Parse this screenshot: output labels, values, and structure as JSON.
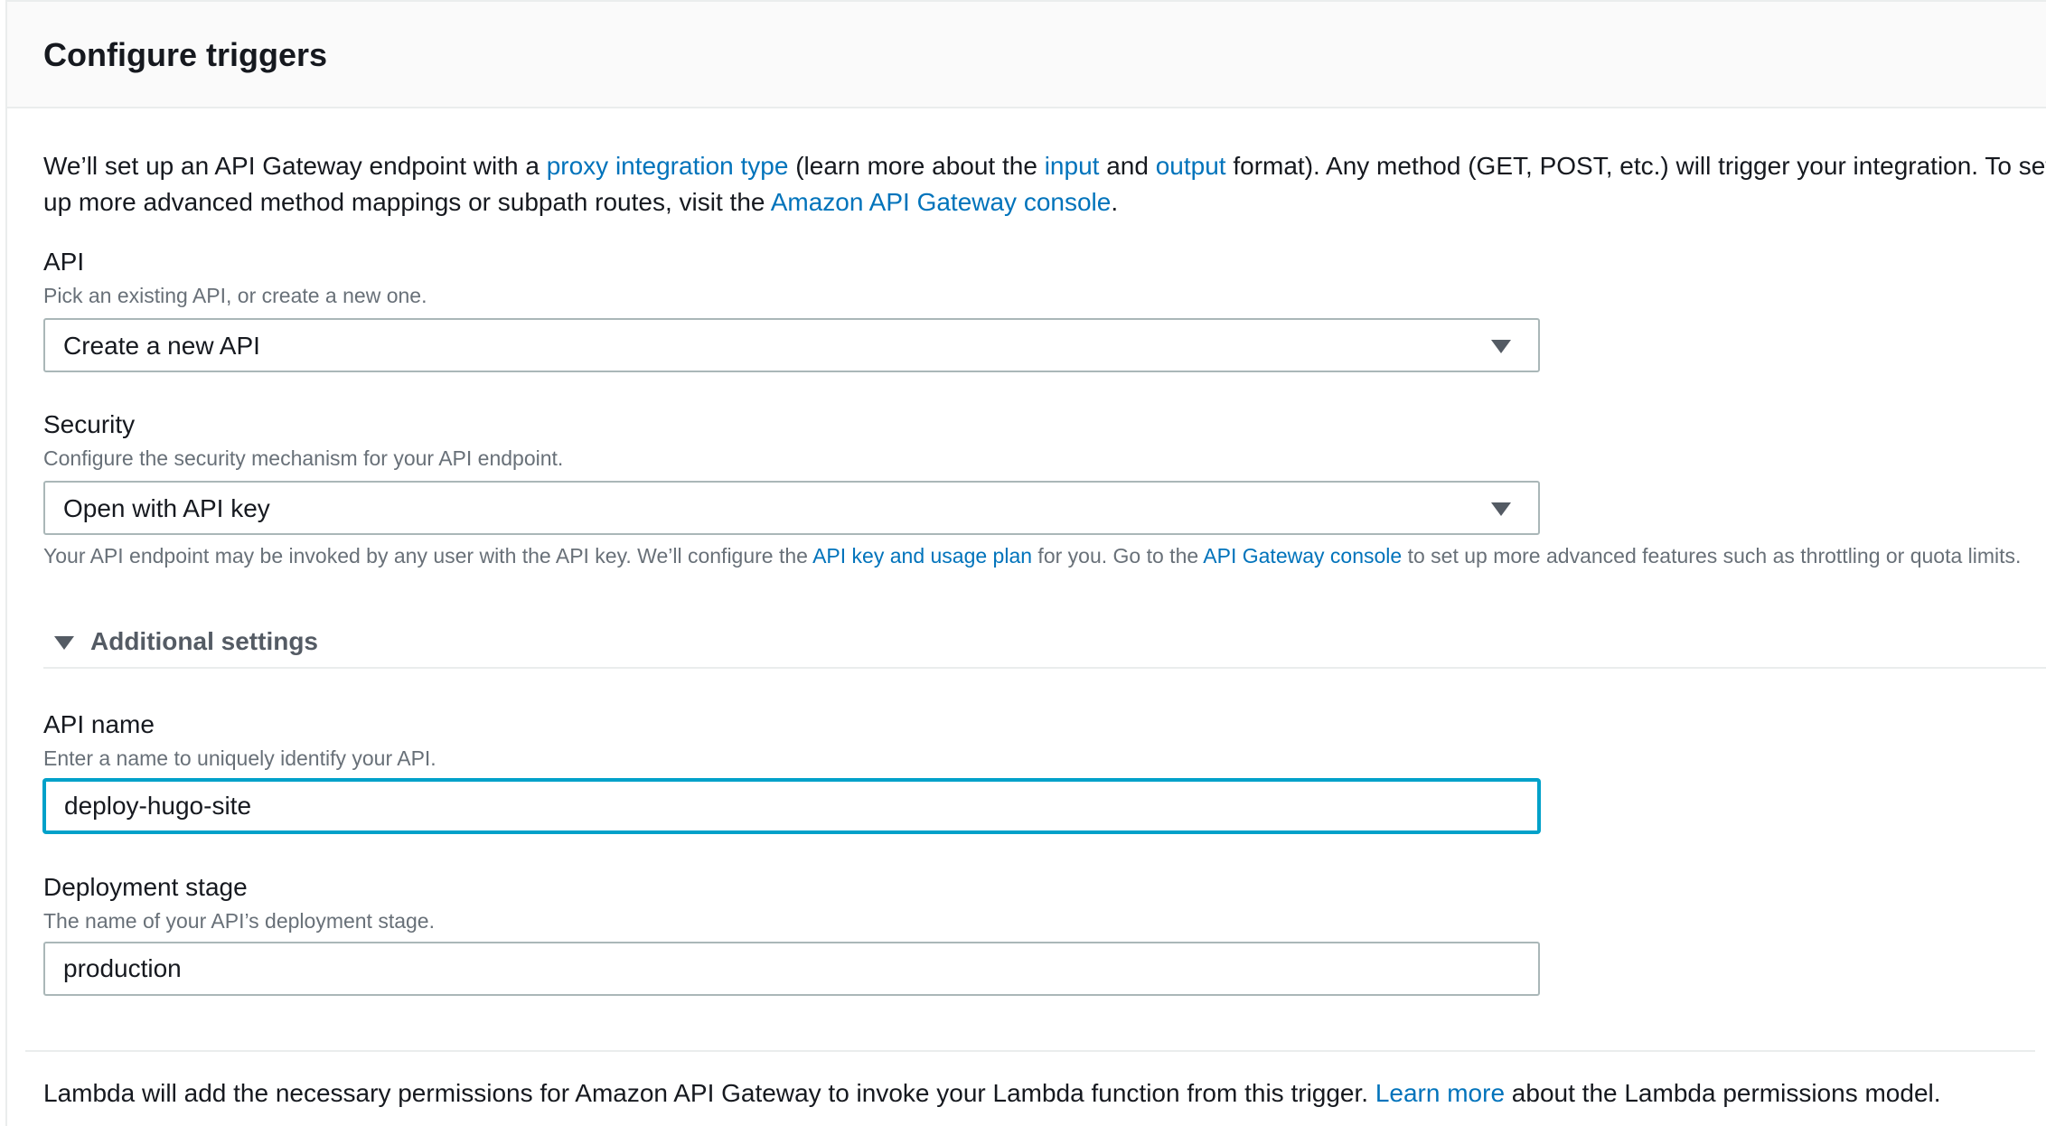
{
  "panel": {
    "title": "Configure triggers"
  },
  "intro": {
    "part1": "We’ll set up an API Gateway endpoint with a ",
    "link_proxy": "proxy integration type",
    "part2": " (learn more about the ",
    "link_input": "input",
    "part3": " and ",
    "link_output": "output",
    "part4": " format). Any method (GET, POST, etc.) will trigger your integration. To set up more advanced method mappings or subpath routes, visit the ",
    "link_console": "Amazon API Gateway console",
    "part5": "."
  },
  "api_field": {
    "label": "API",
    "description": "Pick an existing API, or create a new one.",
    "selected": "Create a new API"
  },
  "security_field": {
    "label": "Security",
    "description": "Configure the security mechanism for your API endpoint.",
    "selected": "Open with API key",
    "help_part1": "Your API endpoint may be invoked by any user with the API key. We’ll configure the ",
    "help_link_usage": "API key and usage plan",
    "help_part2": " for you. Go to the ",
    "help_link_console": "API Gateway console",
    "help_part3": " to set up more advanced features such as throttling or quota limits."
  },
  "additional_settings": {
    "label": "Additional settings",
    "expanded": true
  },
  "api_name_field": {
    "label": "API name",
    "description": "Enter a name to uniquely identify your API.",
    "value": "deploy-hugo-site"
  },
  "stage_field": {
    "label": "Deployment stage",
    "description": "The name of your API’s deployment stage.",
    "value": "production"
  },
  "footer": {
    "part1": "Lambda will add the necessary permissions for Amazon API Gateway to invoke your Lambda function from this trigger. ",
    "link_learn_more": "Learn more",
    "part2": " about the Lambda permissions model."
  },
  "colors": {
    "link": "#0073bb",
    "focus_border": "#00a1c9",
    "muted_text": "#687078",
    "header_bg": "#fafafa"
  }
}
